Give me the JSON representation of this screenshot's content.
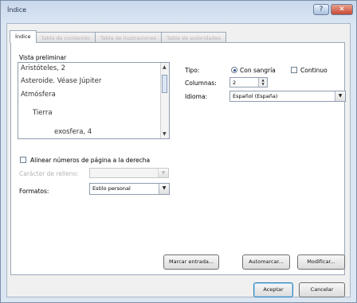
{
  "window": {
    "title": "Índice",
    "help_symbol": "?",
    "close_symbol": "✕"
  },
  "tabs": [
    {
      "label": "Índice"
    },
    {
      "label": "Tabla de contenido"
    },
    {
      "label": "Tabla de ilustraciones"
    },
    {
      "label": "Tabla de autoridades"
    }
  ],
  "preview": {
    "label": "Vista preliminar",
    "lines": [
      "Aristóteles, 2",
      "Asteroide. Véase Júpiter",
      "Atmósfera",
      "Tierra",
      "exosfera, 4"
    ]
  },
  "type": {
    "label": "Tipo:",
    "options": [
      "Con sangría",
      "Continuo"
    ],
    "selected": "Con sangría"
  },
  "columns": {
    "label": "Columnas:",
    "value": "2"
  },
  "language": {
    "label": "Idioma:",
    "value": "Español (España)"
  },
  "align_right": {
    "label": "Alinear números de página a la derecha",
    "checked": false
  },
  "tab_leader": {
    "label": "Carácter de relleno:",
    "value": ""
  },
  "formats": {
    "label": "Formatos:",
    "value": "Estilo personal"
  },
  "buttons": {
    "mark_entry": "Marcar entrada...",
    "automark": "Automarcar...",
    "modify": "Modificar...",
    "ok": "Aceptar",
    "cancel": "Cancelar"
  }
}
